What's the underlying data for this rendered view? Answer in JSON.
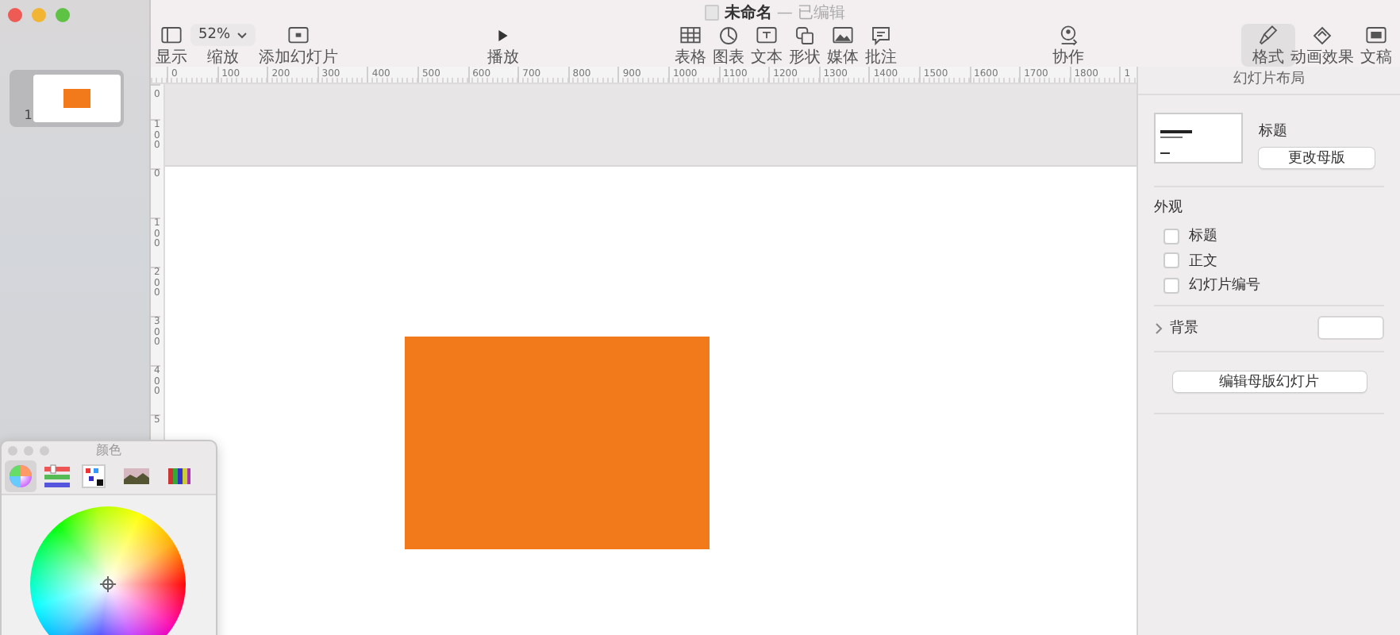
{
  "window": {
    "title": "未命名",
    "subtitle": "— 已编辑"
  },
  "toolbar": [
    {
      "items": [
        {
          "kind": "icon",
          "label": "显示"
        },
        {
          "kind": "zoom",
          "label": "缩放",
          "value": "52%"
        },
        {
          "kind": "icon",
          "label": "添加幻灯片"
        }
      ]
    },
    {
      "items": [
        {
          "kind": "icon",
          "label": "播放"
        }
      ]
    },
    {
      "items": [
        {
          "kind": "icon",
          "label": "表格"
        },
        {
          "kind": "icon",
          "label": "图表"
        },
        {
          "kind": "icon",
          "label": "文本"
        },
        {
          "kind": "icon",
          "label": "形状"
        },
        {
          "kind": "icon",
          "label": "媒体"
        },
        {
          "kind": "icon",
          "label": "批注"
        }
      ]
    },
    {
      "items": [
        {
          "kind": "icon",
          "label": "协作"
        }
      ]
    },
    {
      "items": [
        {
          "kind": "tab",
          "label": "格式",
          "selected": true
        },
        {
          "kind": "tab",
          "label": "动画效果",
          "selected": false
        },
        {
          "kind": "tab",
          "label": "文稿",
          "selected": false
        }
      ]
    }
  ],
  "slides": [
    {
      "number": "1",
      "selected": true
    }
  ],
  "ruler": {
    "horizontal": [
      "0",
      "100",
      "200",
      "300",
      "400",
      "500",
      "600",
      "700",
      "800",
      "900",
      "1000",
      "1100",
      "1200",
      "1300",
      "1400",
      "1500",
      "1600",
      "1700",
      "1800",
      "1"
    ],
    "vertical": [
      "0",
      "100",
      "0",
      "100",
      "200",
      "300",
      "400",
      "5"
    ]
  },
  "inspector": {
    "header": "幻灯片布局",
    "layout_name": "标题",
    "change_master": "更改母版",
    "appearance_title": "外观",
    "appearance": [
      {
        "label": "标题",
        "checked": false
      },
      {
        "label": "正文",
        "checked": false
      },
      {
        "label": "幻灯片编号",
        "checked": false
      }
    ],
    "background": {
      "label": "背景",
      "expanded": false,
      "color": "#ffffff"
    },
    "edit_master": "编辑母版幻灯片"
  },
  "color_panel": {
    "title": "颜色",
    "modes": [
      {
        "selected": true
      },
      {
        "selected": false
      },
      {
        "selected": false
      },
      {
        "selected": false
      },
      {
        "selected": false
      }
    ]
  },
  "slide_shape": {
    "color": "#f27a1a"
  }
}
